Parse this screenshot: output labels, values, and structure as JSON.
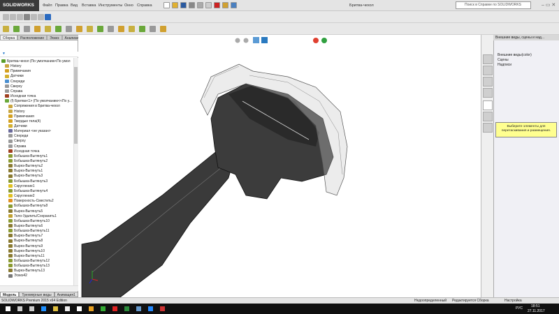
{
  "app": {
    "logo": "SOLIDWORKS",
    "title": "Бритва-чехол"
  },
  "menu": [
    "Файл",
    "Правка",
    "Вид",
    "Вставка",
    "Инструменты",
    "Окно",
    "Справка"
  ],
  "search": {
    "placeholder": "Поиск в Справке по SOLIDWORKS"
  },
  "command_tabs": [
    {
      "label": "Сборка",
      "active": true
    },
    {
      "label": "Расположение"
    },
    {
      "label": "Эскиз"
    },
    {
      "label": "Анализировать"
    },
    {
      "label": "Добавления SOLIDWORKS"
    },
    {
      "label": "SOLIDWORKS MBD"
    }
  ],
  "tree": {
    "items": [
      {
        "label": "Бритва-чехол  (По умолчанию<По умол",
        "indent": 0,
        "color": "#5a9e2a"
      },
      {
        "label": "History",
        "indent": 1,
        "color": "#c9a640"
      },
      {
        "label": "Примечания",
        "indent": 1,
        "color": "#d4a020"
      },
      {
        "label": "Датчики",
        "indent": 1,
        "color": "#d4b030"
      },
      {
        "label": "Спереди",
        "indent": 1,
        "color": "#4a8fd0"
      },
      {
        "label": "Сверху",
        "indent": 1,
        "color": "#999"
      },
      {
        "label": "Справа",
        "indent": 1,
        "color": "#999"
      },
      {
        "label": "Исходная точка",
        "indent": 1,
        "color": "#a04020"
      },
      {
        "label": "(f) Бритва<1> (По умолчанию<<По у...",
        "indent": 1,
        "color": "#6aa83a"
      },
      {
        "label": "Сопряжения в Бритва-чехол",
        "indent": 2,
        "color": "#c9a640"
      },
      {
        "label": "History",
        "indent": 2,
        "color": "#c9a640"
      },
      {
        "label": "Примечания",
        "indent": 2,
        "color": "#d4a020"
      },
      {
        "label": "Твердые тела(4)",
        "indent": 2,
        "color": "#d4a020"
      },
      {
        "label": "Датчики",
        "indent": 2,
        "color": "#d4b030"
      },
      {
        "label": "Материал <не указан>",
        "indent": 2,
        "color": "#6a6a9a"
      },
      {
        "label": "Спереди",
        "indent": 2,
        "color": "#999"
      },
      {
        "label": "Сверху",
        "indent": 2,
        "color": "#999"
      },
      {
        "label": "Справа",
        "indent": 2,
        "color": "#999"
      },
      {
        "label": "Исходная точка",
        "indent": 2,
        "color": "#a04020"
      },
      {
        "label": "Бобышка-Вытянуть1",
        "indent": 2,
        "color": "#8a9a30"
      },
      {
        "label": "Бобышка-Вытянуть2",
        "indent": 2,
        "color": "#8a9a30"
      },
      {
        "label": "Вырез-Вытянуть2",
        "indent": 2,
        "color": "#8a7a30"
      },
      {
        "label": "Вырез-Вытянуть1",
        "indent": 2,
        "color": "#8a7a30"
      },
      {
        "label": "Вырез-Вытянуть3",
        "indent": 2,
        "color": "#8a7a30"
      },
      {
        "label": "Бобышка-Вытянуть3",
        "indent": 2,
        "color": "#8a9a30"
      },
      {
        "label": "Скругление1",
        "indent": 2,
        "color": "#e0c020"
      },
      {
        "label": "Бобышка-Вытянуть4",
        "indent": 2,
        "color": "#8a9a30"
      },
      {
        "label": "Скругление2",
        "indent": 2,
        "color": "#e0c020"
      },
      {
        "label": "Поверхность-Сместить2",
        "indent": 2,
        "color": "#e09020"
      },
      {
        "label": "Бобышка-Вытянуть8",
        "indent": 2,
        "color": "#8a9a30"
      },
      {
        "label": "Вырез-Вытянуть5",
        "indent": 2,
        "color": "#8a7a30"
      },
      {
        "label": "Тело-Удалить/Сохранить1",
        "indent": 2,
        "color": "#c0a030"
      },
      {
        "label": "Бобышка-Вытянуть10",
        "indent": 2,
        "color": "#8a9a30"
      },
      {
        "label": "Вырез-Вытянуть6",
        "indent": 2,
        "color": "#8a7a30"
      },
      {
        "label": "Бобышка-Вытянуть11",
        "indent": 2,
        "color": "#8a9a30"
      },
      {
        "label": "Вырез-Вытянуть7",
        "indent": 2,
        "color": "#8a7a30"
      },
      {
        "label": "Вырез-Вытянуть8",
        "indent": 2,
        "color": "#8a7a30"
      },
      {
        "label": "Вырез-Вытянуть9",
        "indent": 2,
        "color": "#8a7a30"
      },
      {
        "label": "Вырез-Вытянуть10",
        "indent": 2,
        "color": "#8a7a30"
      },
      {
        "label": "Вырез-Вытянуть11",
        "indent": 2,
        "color": "#8a7a30"
      },
      {
        "label": "Бобышка-Вытянуть12",
        "indent": 2,
        "color": "#8a9a30"
      },
      {
        "label": "Бобышка-Вытянуть13",
        "indent": 2,
        "color": "#8a9a30"
      },
      {
        "label": "Вырез-Вытянуть13",
        "indent": 2,
        "color": "#8a7a30"
      },
      {
        "label": "Эскиз42",
        "indent": 2,
        "color": "#777"
      }
    ]
  },
  "filter_label": "▼",
  "bottom_tabs": [
    {
      "label": "Модель",
      "active": true
    },
    {
      "label": "Трехмерные виды"
    },
    {
      "label": "Анимация1"
    }
  ],
  "task_pane": {
    "title": "Внешние виды, сцены и над...",
    "items": [
      "Внешние виды(color)",
      "Сцены",
      "Надписи"
    ],
    "hint": "Выберите элементы для перетаскивания и размещения."
  },
  "status": {
    "edition": "SOLIDWORKS Premium 2015 x64 Edition",
    "state": "Недоопределенный",
    "mode": "Редактируется Сборка",
    "settings": "Настройка"
  },
  "taskbar": {
    "lang": "РУС",
    "time": "18:51",
    "date": "27.11.2017"
  }
}
